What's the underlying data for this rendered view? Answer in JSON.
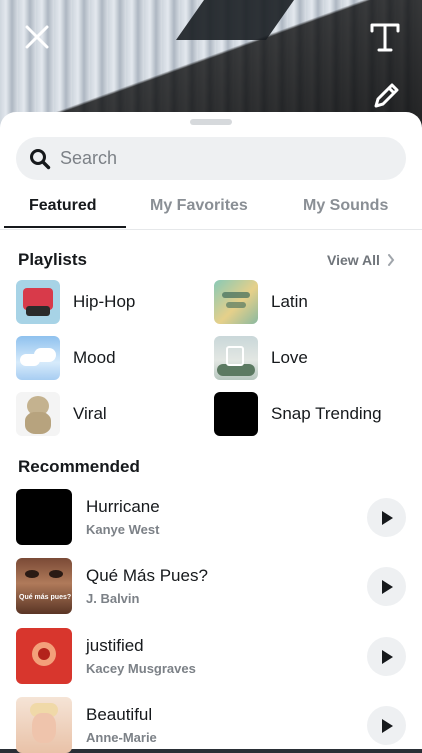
{
  "search": {
    "placeholder": "Search"
  },
  "tabs": [
    {
      "label": "Featured",
      "active": true
    },
    {
      "label": "My Favorites",
      "active": false
    },
    {
      "label": "My Sounds",
      "active": false
    }
  ],
  "playlists": {
    "title": "Playlists",
    "view_all": "View All",
    "items": [
      {
        "label": "Hip-Hop"
      },
      {
        "label": "Latin"
      },
      {
        "label": "Mood"
      },
      {
        "label": "Love"
      },
      {
        "label": "Viral"
      },
      {
        "label": "Snap Trending"
      }
    ]
  },
  "recommended": {
    "title": "Recommended",
    "items": [
      {
        "title": "Hurricane",
        "artist": "Kanye West"
      },
      {
        "title": "Qué Más Pues?",
        "artist": "J. Balvin",
        "art_text": "Qué más pues?"
      },
      {
        "title": "justified",
        "artist": "Kacey Musgraves"
      },
      {
        "title": "Beautiful",
        "artist": "Anne-Marie"
      }
    ]
  },
  "colors": {
    "sheet_bg": "#ffffff",
    "search_bg": "#eef0f2",
    "primary_text": "#16191c",
    "secondary_text": "#7c8187"
  },
  "icons": {
    "close": "close-icon",
    "text_tool": "text-tool-icon",
    "pencil": "pencil-icon",
    "search": "search-icon",
    "play": "play-icon",
    "chevron": "chevron-right-icon"
  }
}
